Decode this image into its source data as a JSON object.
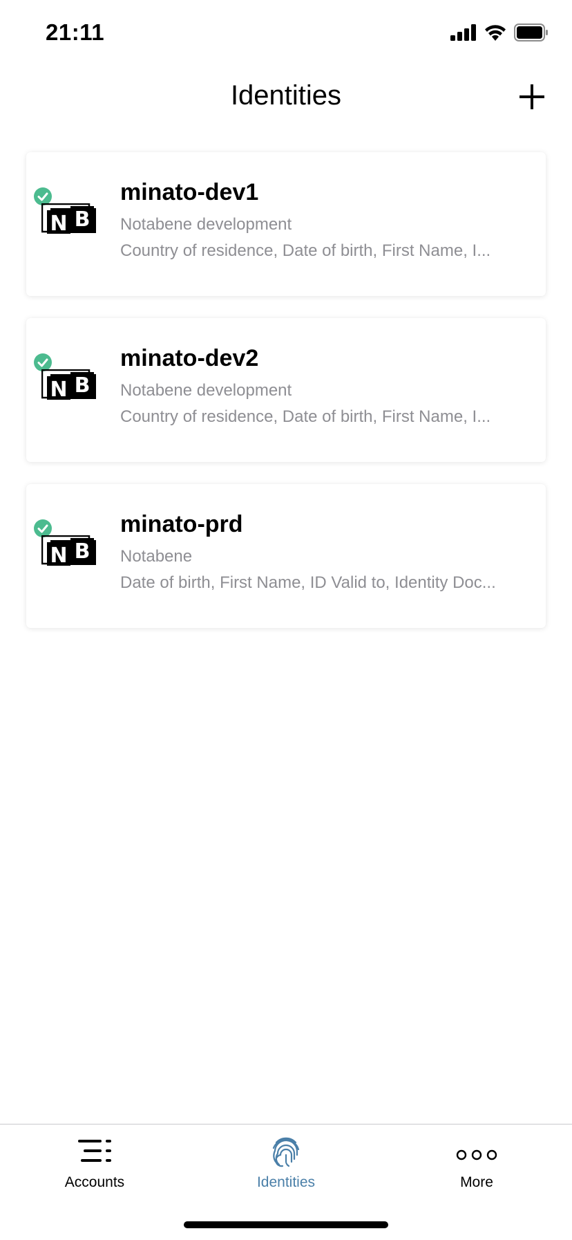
{
  "status_bar": {
    "time": "21:11"
  },
  "header": {
    "title": "Identities"
  },
  "identities": [
    {
      "name": "minato-dev1",
      "organization": "Notabene development",
      "attributes": "Country of residence, Date of birth, First Name, I...",
      "verified": true,
      "logo_text": "NB"
    },
    {
      "name": "minato-dev2",
      "organization": "Notabene development",
      "attributes": "Country of residence, Date of birth, First Name, I...",
      "verified": true,
      "logo_text": "NB"
    },
    {
      "name": "minato-prd",
      "organization": "Notabene",
      "attributes": "Date of birth, First Name, ID Valid to, Identity Doc...",
      "verified": true,
      "logo_text": "NB"
    }
  ],
  "tab_bar": {
    "tabs": [
      {
        "label": "Accounts",
        "icon": "accounts-list-icon",
        "active": false
      },
      {
        "label": "Identities",
        "icon": "fingerprint-icon",
        "active": true
      },
      {
        "label": "More",
        "icon": "more-dots-icon",
        "active": false
      }
    ]
  },
  "colors": {
    "verified_green": "#4cbb8f",
    "active_tab": "#4a7fa8",
    "secondary_text": "#8e8e93"
  }
}
